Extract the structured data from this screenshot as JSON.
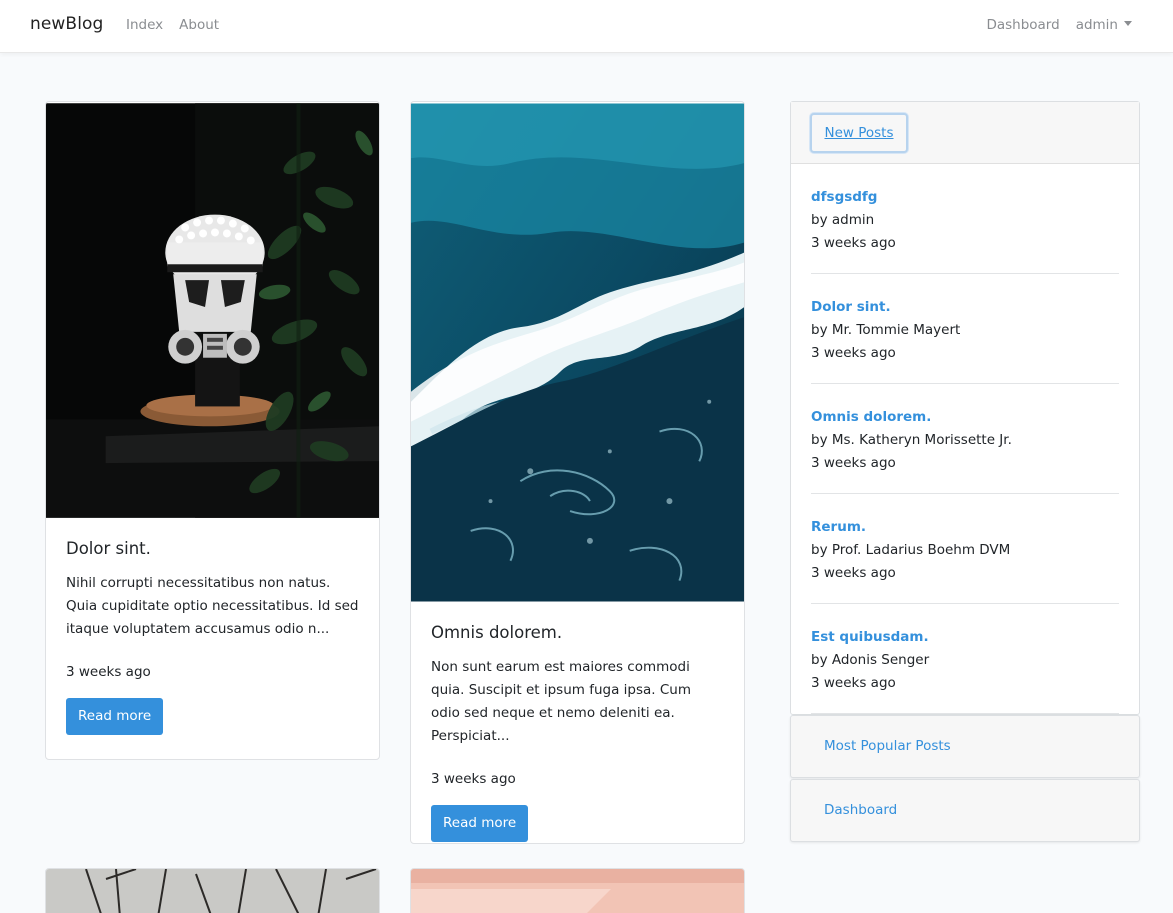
{
  "navbar": {
    "brand": "newBlog",
    "links": [
      "Index",
      "About"
    ],
    "dashboard": "Dashboard",
    "user": "admin"
  },
  "posts": [
    {
      "title": "Dolor sint.",
      "excerpt": "Nihil corrupti necessitatibus non natus. Quia cupiditate optio necessitatibus. Id sed itaque voluptatem accusamus odio n...",
      "date": "3 weeks ago",
      "button": "Read more",
      "image": "lego-stormtrooper-helmet-photo"
    },
    {
      "title": "Omnis dolorem.",
      "excerpt": "Non sunt earum est maiores commodi quia. Suscipit et ipsum fuga ipsa. Cum odio sed neque et nemo deleniti ea. Perspiciat...",
      "date": "3 weeks ago",
      "button": "Read more",
      "image": "ocean-wave-aerial-photo"
    }
  ],
  "sidebar": {
    "tab_label": "New Posts",
    "items": [
      {
        "title": "dfsgsdfg",
        "author": "by admin",
        "date": "3 weeks ago"
      },
      {
        "title": "Dolor sint.",
        "author": "by Mr. Tommie Mayert",
        "date": "3 weeks ago"
      },
      {
        "title": "Omnis dolorem.",
        "author": "by Ms. Katheryn Morissette Jr.",
        "date": "3 weeks ago"
      },
      {
        "title": "Rerum.",
        "author": "by Prof. Ladarius Boehm DVM",
        "date": "3 weeks ago"
      },
      {
        "title": "Est quibusdam.",
        "author": "by Adonis Senger",
        "date": "3 weeks ago"
      }
    ],
    "popular_label": "Most Popular Posts",
    "dashboard_label": "Dashboard"
  },
  "colors": {
    "accent": "#3490dc",
    "background": "#f8fafc"
  }
}
